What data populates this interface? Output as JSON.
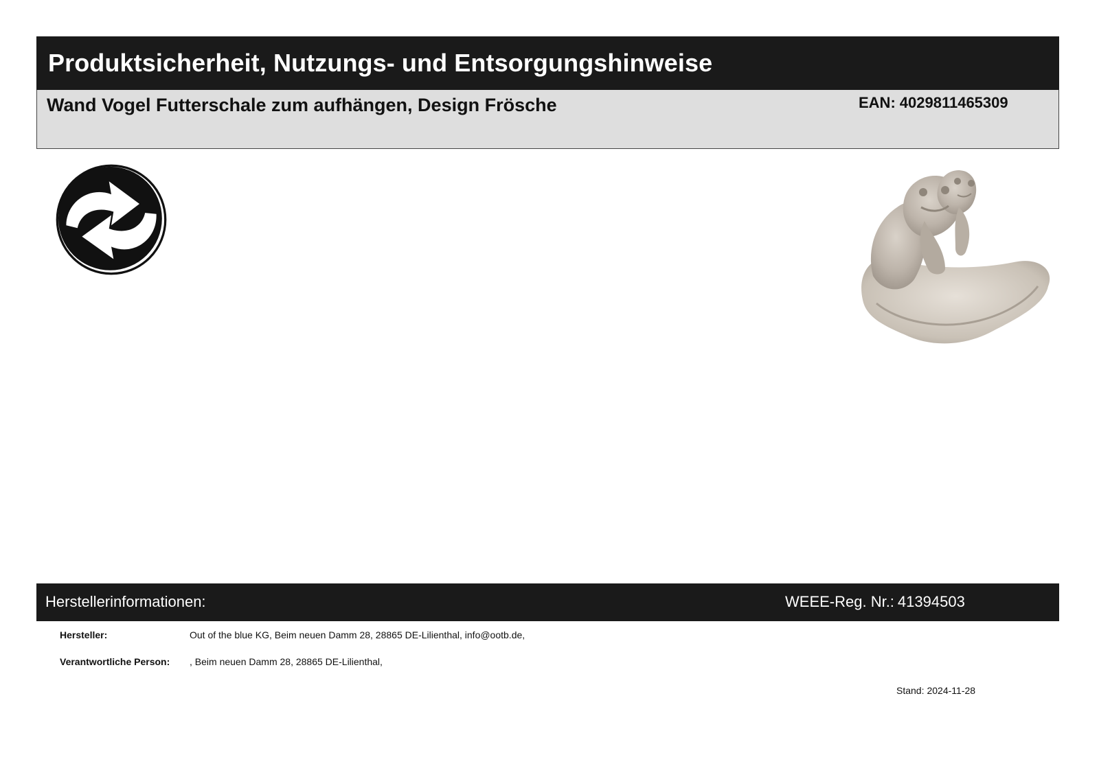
{
  "header": {
    "title": "Produktsicherheit, Nutzungs- und Entsorgungshinweise"
  },
  "product": {
    "name": "Wand Vogel Futterschale zum aufhängen, Design Frösche",
    "ean_label": "EAN:",
    "ean_value": "4029811465309"
  },
  "symbols": {
    "recycling_icon": "green-dot-recycling-icon",
    "product_image": "frog-bird-feeder-bowl"
  },
  "manufacturer_section": {
    "title": "Herstellerinformationen:",
    "weee_label": "WEEE-Reg. Nr.:",
    "weee_value": "41394503"
  },
  "info": {
    "hersteller_label": "Hersteller:",
    "hersteller_value": "Out of the blue KG, Beim neuen Damm 28, 28865 DE-Lilienthal, info@ootb.de,",
    "person_label": "Verantwortliche Person:",
    "person_value": ", Beim neuen Damm 28, 28865 DE-Lilienthal,"
  },
  "footer": {
    "stand_label": "Stand:",
    "stand_value": "2024-11-28"
  },
  "colors": {
    "header_background": "#1a1a1a",
    "product_bar_background": "#dedede",
    "text": "#111111"
  }
}
